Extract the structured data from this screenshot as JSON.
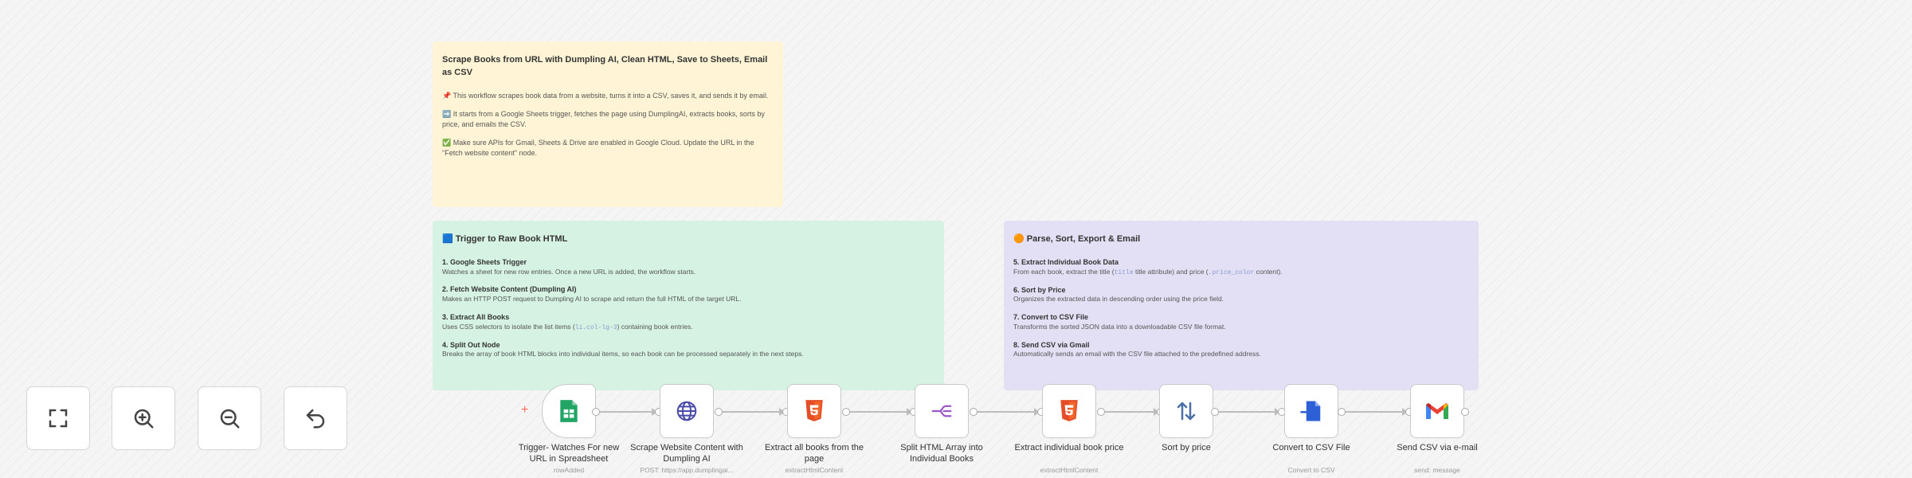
{
  "notes": {
    "main": {
      "title": "Scrape Books from URL with Dumpling AI, Clean HTML, Save to Sheets, Email as CSV",
      "paragraphs": [
        "📌 This workflow scrapes book data from a website, turns it into a CSV, saves it, and sends it by email.",
        "➡️ It starts from a Google Sheets trigger, fetches the page using DumplingAI, extracts books, sorts by price, and emails the CSV.",
        "✅ Make sure APIs for Gmail, Sheets & Drive are enabled in Google Cloud. Update the URL in the \"Fetch website content\" node."
      ]
    },
    "trigger": {
      "title": "🟦 Trigger to Raw Book HTML",
      "steps": [
        {
          "title": "1. Google Sheets Trigger",
          "desc": "Watches a sheet for new row entries. Once a new URL is added, the workflow starts."
        },
        {
          "title": "2. Fetch Website Content (Dumpling AI)",
          "desc": "Makes an HTTP POST request to Dumpling AI to scrape and return the full HTML of the target URL."
        },
        {
          "title": "3. Extract All Books",
          "desc_pre": "Uses CSS selectors to isolate the list items (",
          "code": "li.col-lg-3",
          "desc_post": ") containing book entries."
        },
        {
          "title": "4. Split Out Node",
          "desc": "Breaks the array of book HTML blocks into individual items, so each book can be processed separately in the next steps."
        }
      ]
    },
    "parse": {
      "title": "🟠 Parse, Sort, Export & Email",
      "steps": [
        {
          "title": "5. Extract Individual Book Data",
          "desc_pre": "From each book, extract the title (",
          "code1": "title",
          "desc_mid": " title attribute) and price (",
          "code2": ".price_color",
          "desc_post": " content)."
        },
        {
          "title": "6. Sort by Price",
          "desc": "Organizes the extracted data in descending order using the price field."
        },
        {
          "title": "7. Convert to CSV File",
          "desc": "Transforms the sorted JSON data into a downloadable CSV file format."
        },
        {
          "title": "8. Send CSV via Gmail",
          "desc": "Automatically sends an email with the CSV file attached to the predefined address."
        }
      ]
    }
  },
  "controls": {
    "fit": "fit-view",
    "zoom_in": "zoom-in",
    "zoom_out": "zoom-out",
    "undo": "undo"
  },
  "nodes": [
    {
      "label": "Trigger- Watches For new URL in Spreadsheet",
      "sub": "rowAdded",
      "icon": "google-sheets-icon"
    },
    {
      "label": "Scrape Website Content with Dumpling AI",
      "sub": "POST: https://app.dumplingai...",
      "icon": "globe-icon"
    },
    {
      "label": "Extract all books from the page",
      "sub": "extractHtmlContent",
      "icon": "html5-icon"
    },
    {
      "label": "Split HTML Array into Individual Books",
      "sub": "",
      "icon": "split-icon"
    },
    {
      "label": "Extract individual book price",
      "sub": "extractHtmlContent",
      "icon": "html5-icon"
    },
    {
      "label": "Sort by price",
      "sub": "",
      "icon": "sort-icon"
    },
    {
      "label": "Convert to CSV File",
      "sub": "Convert to CSV",
      "icon": "file-convert-icon"
    },
    {
      "label": "Send CSV via e-mail",
      "sub": "send: message",
      "icon": "gmail-icon"
    }
  ],
  "colors": {
    "main_note": "#fff5d6",
    "trigger_note": "#d5f2e2",
    "parse_note": "#e3e0f5",
    "accent": "#ff6d5a",
    "sheets_green": "#21a464",
    "globe_blue": "#4a4aa8",
    "html_orange": "#e44d26",
    "split_purple": "#9b59c7",
    "sort_blue": "#4a6fa8",
    "convert_blue": "#2d5fd6"
  }
}
